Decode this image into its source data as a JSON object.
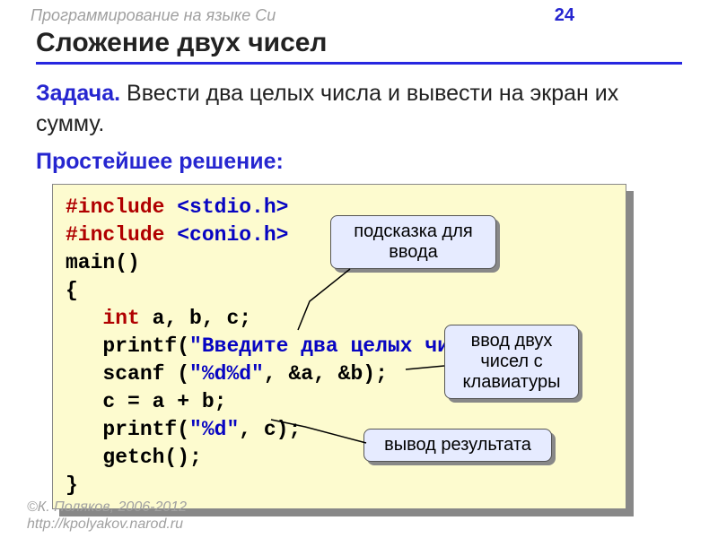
{
  "header": {
    "course": "Программирование на языке Си",
    "page": "24"
  },
  "title": "Сложение двух чисел",
  "task": {
    "label": "Задача.",
    "text": "Ввести два целых числа и вывести на экран их сумму."
  },
  "solution_label": "Простейшее решение:",
  "code": {
    "include1_kw": "#include ",
    "include1_lib": "<stdio.h>",
    "include2_kw": "#include ",
    "include2_lib": "<conio.h>",
    "main": "main()",
    "brace_open": "{",
    "int_kw": "int",
    "decl_rest": " a, b, c;",
    "printf1_a": "   printf(",
    "printf1_str": "\"Введите два целых числа\\n\"",
    "printf1_b": ");",
    "scanf_a": "   scanf (",
    "scanf_str": "\"%d%d\"",
    "scanf_b": ", &a, &b);",
    "assign": "   c = a + b;",
    "printf2_a": "   printf(",
    "printf2_str": "\"%d\"",
    "printf2_b": ", c);",
    "getch": "   getch();",
    "brace_close": "}"
  },
  "callouts": {
    "c1": "подсказка для ввода",
    "c2": "ввод двух чисел с клавиатуры",
    "c3": "вывод результата"
  },
  "footer": {
    "l1": "©К. Поляков, 2006-2012",
    "l2": "http://kpolyakov.narod.ru"
  }
}
